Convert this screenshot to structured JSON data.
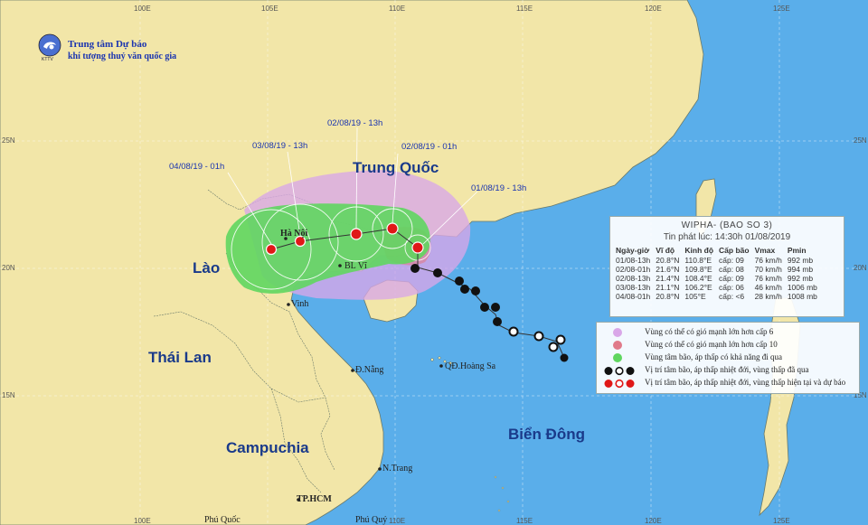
{
  "org": {
    "line1": "Trung tâm Dự báo",
    "line2": "khí tượng thuỷ văn quốc gia",
    "logo_text": "KTTV"
  },
  "grid": {
    "lon_labels": [
      "100E",
      "105E",
      "110E",
      "115E",
      "120E",
      "125E"
    ],
    "lat_labels": [
      "25N",
      "20N",
      "15N"
    ]
  },
  "countries": {
    "china": "Trung Quốc",
    "laos": "Lào",
    "thailand": "Thái Lan",
    "cambodia": "Campuchia",
    "sea": "Biển Đông"
  },
  "places": {
    "hanoi": "Hà Nội",
    "bachlongvi": "BL Vĩ",
    "vinh": "Vinh",
    "danang": "Đ.Nẵng",
    "hoangsa": "QĐ.Hoàng Sa",
    "nhatrang": "N.Trang",
    "hcm": "TP.HCM",
    "phuquoc": "Phú Quốc",
    "phuquy": "Phú Quý"
  },
  "track_labels": [
    "04/08/19 - 01h",
    "03/08/19 - 13h",
    "02/08/19 - 13h",
    "02/08/19 - 01h",
    "01/08/19 - 13h"
  ],
  "info": {
    "title": "WIPHA- (BAO SO 3)",
    "issued": "Tin phát lúc: 14:30h 01/08/2019",
    "headers": [
      "Ngày-giờ",
      "Vĩ độ",
      "Kinh độ",
      "Cấp bão",
      "Vmax",
      "Pmin"
    ],
    "rows": [
      [
        "01/08-13h",
        "20.8°N",
        "110.8°E",
        "cấp: 09",
        "76 km/h",
        "992 mb"
      ],
      [
        "02/08-01h",
        "21.6°N",
        "109.8°E",
        "cấp: 08",
        "70 km/h",
        "994 mb"
      ],
      [
        "02/08-13h",
        "21.4°N",
        "108.4°E",
        "cấp: 09",
        "76 km/h",
        "992 mb"
      ],
      [
        "03/08-13h",
        "21.1°N",
        "106.2°E",
        "cấp: 06",
        "46 km/h",
        "1006 mb"
      ],
      [
        "04/08-01h",
        "20.8°N",
        "105°E",
        "cấp: <6",
        "28 km/h",
        "1008 mb"
      ]
    ]
  },
  "legend": [
    {
      "text": "Vùng có thể có gió mạnh lớn hơn cấp 6",
      "color": "#d9a7e8"
    },
    {
      "text": "Vùng có thể có gió mạnh lớn hơn cấp 10",
      "color": "#e07a8a"
    },
    {
      "text": "Vùng tâm bão, áp thấp có khả năng đi qua",
      "color": "#5fd65f"
    },
    {
      "text": "Vị trí tâm bão, áp thấp nhiệt đới, vùng thấp đã qua",
      "color": "#000000"
    },
    {
      "text": "Vị trí tâm bão, áp thấp nhiệt đới, vùng thấp hiện tại và dự báo",
      "color": "#e01818"
    }
  ],
  "colors": {
    "sea": "#5aaeea",
    "land": "#f2e6a8",
    "cone_green": "#5fd65f",
    "wind6": "#d9a7e8",
    "storm_red": "#e01818"
  }
}
